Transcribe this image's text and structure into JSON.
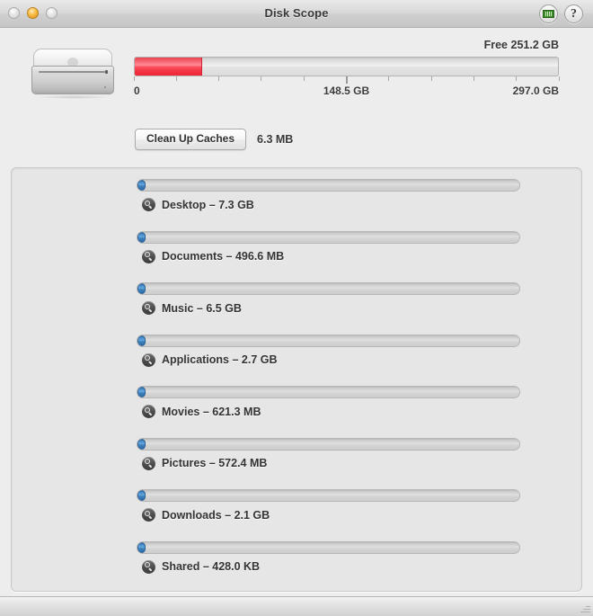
{
  "window": {
    "title": "Disk Scope",
    "controls": {
      "close": "close-button",
      "minimize": "minimize-button",
      "zoom": "zoom-button"
    },
    "actions": {
      "memory_label": "memory-module-icon",
      "help_label": "?"
    }
  },
  "disk": {
    "device_icon": "mac-mini-icon",
    "free_text": "Free 251.2 GB",
    "free_value": 251.2,
    "free_unit": "GB",
    "capacity_value": 297.0,
    "used_value": 45.8,
    "used_percent": 16,
    "axis": {
      "min_label": "0",
      "mid_label": "148.5 GB",
      "max_label": "297.0 GB",
      "min_value": 0,
      "mid_value": 148.5,
      "max_value": 297.0,
      "tick_count": 11,
      "major_tick_index": 5
    },
    "cleanup": {
      "button_label": "Clean Up Caches",
      "size_label": "6.3 MB"
    }
  },
  "folders": [
    {
      "name": "Desktop",
      "size_label": "7.3 GB",
      "label": "Desktop – 7.3 GB",
      "bar_percent": 2.2
    },
    {
      "name": "Documents",
      "size_label": "496.6 MB",
      "label": "Documents – 496.6 MB",
      "bar_percent": 2.2
    },
    {
      "name": "Music",
      "size_label": "6.5 GB",
      "label": "Music – 6.5 GB",
      "bar_percent": 2.2
    },
    {
      "name": "Applications",
      "size_label": "2.7 GB",
      "label": "Applications – 2.7 GB",
      "bar_percent": 2.2
    },
    {
      "name": "Movies",
      "size_label": "621.3 MB",
      "label": "Movies – 621.3 MB",
      "bar_percent": 2.2
    },
    {
      "name": "Pictures",
      "size_label": "572.4 MB",
      "label": "Pictures – 572.4 MB",
      "bar_percent": 2.2
    },
    {
      "name": "Downloads",
      "size_label": "2.1 GB",
      "label": "Downloads – 2.1 GB",
      "bar_percent": 2.2
    },
    {
      "name": "Shared",
      "size_label": "428.0 KB",
      "label": "Shared – 428.0 KB",
      "bar_percent": 2.2
    }
  ],
  "colors": {
    "used_fill": "#f23141",
    "folder_fill": "#3e83bf",
    "window_bg": "#ededed",
    "panel_bg": "#e6e6e6",
    "memory_icon": "#3f8c2d"
  }
}
